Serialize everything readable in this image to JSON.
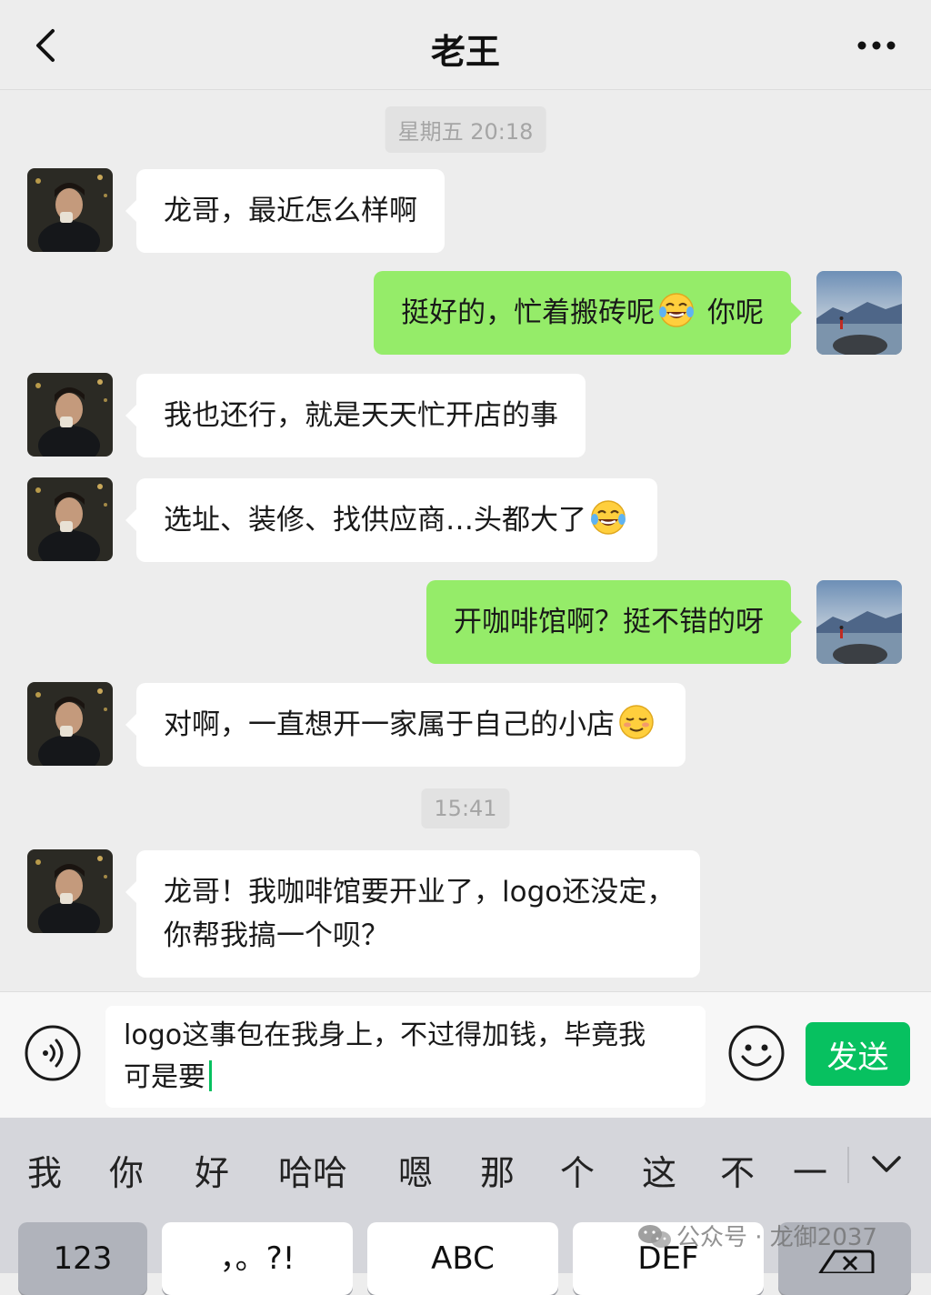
{
  "header": {
    "title": "老王",
    "back_icon": "chevron-left-icon",
    "more_icon": "ellipsis-icon"
  },
  "chat": {
    "timestamps": [
      "星期五 20:18",
      "15:41"
    ],
    "messages": [
      {
        "side": "left",
        "text": "龙哥，最近怎么样啊"
      },
      {
        "side": "right",
        "text_before_emoji": "挺好的，忙着搬砖呢",
        "emoji": "tears-of-joy-emoji",
        "text_after_emoji": " 你呢"
      },
      {
        "side": "left",
        "text": "我也还行，就是天天忙开店的事"
      },
      {
        "side": "left",
        "text": "选址、装修、找供应商…头都大了",
        "emoji": "tears-of-joy-emoji"
      },
      {
        "side": "right",
        "text": "开咖啡馆啊？挺不错的呀"
      },
      {
        "side": "left",
        "text": "对啊，一直想开一家属于自己的小店",
        "emoji": "smiling-blush-emoji"
      },
      {
        "side": "left",
        "lines": [
          "龙哥！我咖啡馆要开业了，logo还没定，",
          "你帮我搞一个呗？"
        ]
      }
    ]
  },
  "input": {
    "text": "logo这事包在我身上，不过得加钱，毕竟我\n可是要",
    "send_label": "发送",
    "voice_icon": "voice-icon",
    "emoji_icon": "emoji-icon"
  },
  "keyboard": {
    "candidates": [
      "我",
      "你",
      "好",
      "哈哈",
      "嗯",
      "那",
      "个",
      "这",
      "不",
      "一"
    ],
    "keys": [
      "123",
      "，。?!",
      "ABC",
      "DEF"
    ],
    "collapse_icon": "chevron-down-icon",
    "delete_icon": "backspace-icon"
  },
  "watermark": {
    "text": "公众号 · 龙御2037",
    "icon": "wechat-icon"
  },
  "colors": {
    "bubble_self": "#95ec69",
    "bubble_other": "#ffffff",
    "accent": "#07c160",
    "background": "#ededed"
  }
}
